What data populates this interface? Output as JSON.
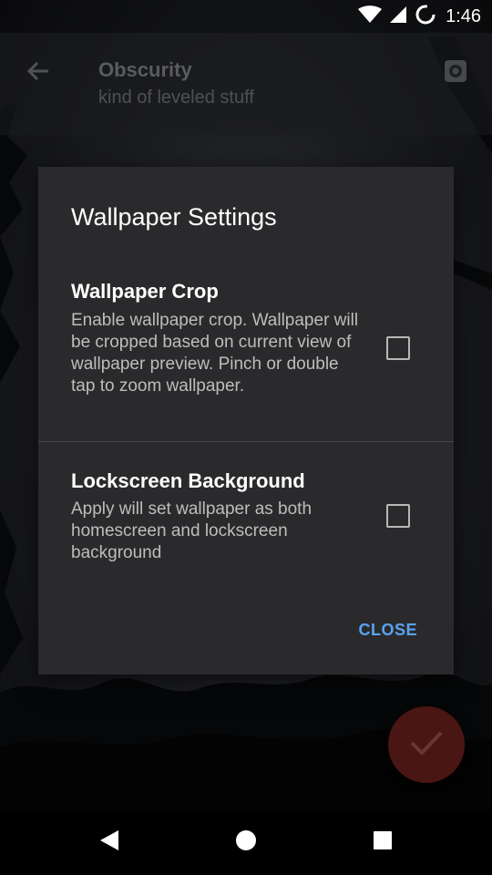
{
  "status_bar": {
    "time": "1:46",
    "icons": [
      "wifi-icon",
      "cell-signal-icon",
      "battery-icon"
    ]
  },
  "app_bar": {
    "title": "Obscurity",
    "subtitle": "kind of leveled stuff",
    "back_icon": "arrow-back-icon",
    "settings_icon": "gear-icon"
  },
  "dialog": {
    "title": "Wallpaper Settings",
    "settings": [
      {
        "title": "Wallpaper Crop",
        "description": "Enable wallpaper crop. Wallpaper will be cropped based on current view of wallpaper preview. Pinch or double tap to zoom wallpaper.",
        "checked": false
      },
      {
        "title": "Lockscreen Background",
        "description": "Apply will set wallpaper as both homescreen and lockscreen background",
        "checked": false
      }
    ],
    "close_label": "CLOSE"
  },
  "fab": {
    "icon": "check-icon"
  },
  "nav_bar": {
    "icons": [
      "nav-back-icon",
      "nav-home-icon",
      "nav-recents-icon"
    ]
  },
  "colors": {
    "accent": "#5aa3f0",
    "dialog_bg": "#2a2a2c",
    "fab_bg": "#4a1613"
  }
}
